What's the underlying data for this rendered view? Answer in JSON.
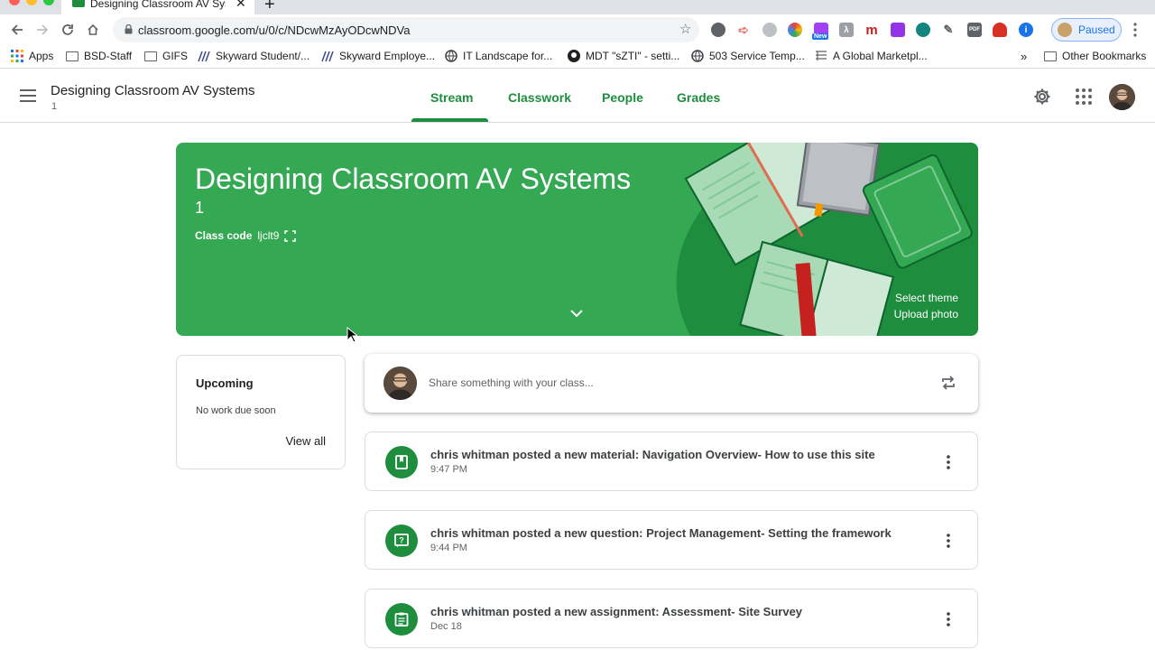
{
  "browser": {
    "tab_title": "Designing Classroom AV Systems",
    "url": "classroom.google.com/u/0/c/NDcwMzAyODcwNDVa",
    "profile_label": "Paused",
    "extension_badge": "New",
    "bookmarks": [
      {
        "label": "Apps",
        "icon": "apps-grid-icon"
      },
      {
        "label": "BSD-Staff",
        "icon": "folder-icon"
      },
      {
        "label": "GIFS",
        "icon": "folder-icon"
      },
      {
        "label": "Skyward Student/...",
        "icon": "skyward-icon"
      },
      {
        "label": "Skyward Employe...",
        "icon": "skyward-icon"
      },
      {
        "label": "IT Landscape for...",
        "icon": "globe-icon"
      },
      {
        "label": "MDT \"sZTI\" - setti...",
        "icon": "github-icon"
      },
      {
        "label": "503 Service Temp...",
        "icon": "globe-icon"
      },
      {
        "label": "A Global Marketpl...",
        "icon": "marketplace-icon"
      }
    ],
    "bookmarks_overflow": "»",
    "other_bookmarks": "Other Bookmarks"
  },
  "header": {
    "class_title": "Designing Classroom AV Systems",
    "class_section": "1",
    "tabs": [
      {
        "label": "Stream",
        "active": true
      },
      {
        "label": "Classwork",
        "active": false
      },
      {
        "label": "People",
        "active": false
      },
      {
        "label": "Grades",
        "active": false
      }
    ]
  },
  "banner": {
    "title": "Designing Classroom AV Systems",
    "section": "1",
    "class_code_label": "Class code",
    "class_code": "ljclt9",
    "select_theme": "Select theme",
    "upload_photo": "Upload photo",
    "color": "#34a853"
  },
  "upcoming": {
    "title": "Upcoming",
    "empty_text": "No work due soon",
    "view_all": "View all"
  },
  "share": {
    "placeholder": "Share something with your class..."
  },
  "posts": [
    {
      "text": "chris whitman posted a new material: Navigation Overview- How to use this site",
      "time": "9:47 PM",
      "icon": "material-icon"
    },
    {
      "text": "chris whitman posted a new question: Project Management- Setting the framework",
      "time": "9:44 PM",
      "icon": "question-icon"
    },
    {
      "text": "chris whitman posted a new assignment: Assessment- Site Survey",
      "time": "Dec 18",
      "icon": "assignment-icon"
    }
  ],
  "colors": {
    "accent": "#1e8e3e",
    "banner": "#34a853"
  }
}
